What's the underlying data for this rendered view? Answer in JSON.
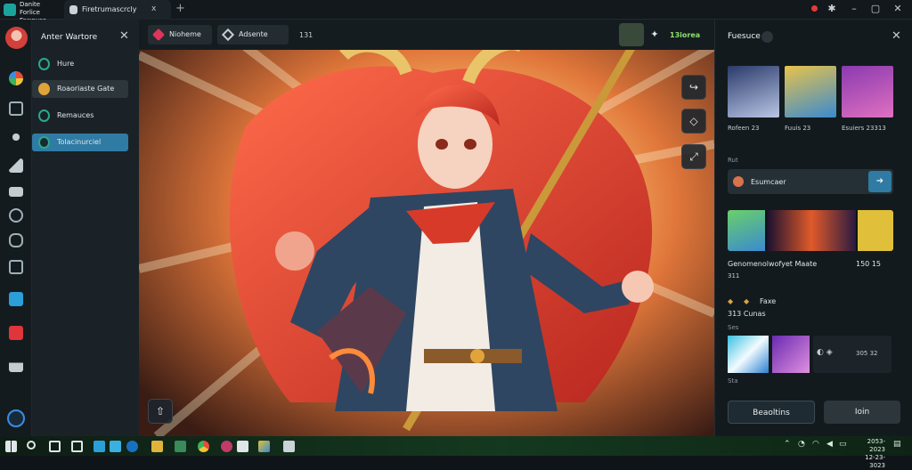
{
  "window": {
    "app_title": "Danite Forlice Fawouse",
    "tab_label": "Firetrumascrcly",
    "tab_close": "ⅹ",
    "new_tab": "+"
  },
  "sidebar": {
    "title": "Anter Wartore",
    "items": [
      {
        "label": "Hure",
        "icon_color": "#2aa98c"
      },
      {
        "label": "Roaoriaste Gate",
        "icon_color": "#e0a43a"
      },
      {
        "label": "Remauces",
        "icon_color": "#2aa98c"
      },
      {
        "label": "Tolacinurciel",
        "icon_color": "#2aa98c"
      }
    ]
  },
  "toolbar": {
    "pill1_label": "Nioheme",
    "pill2_label": "Adsente",
    "count": "131",
    "score_label": "13iorea"
  },
  "right_panel": {
    "title": "Fuesuce",
    "gallery": [
      {
        "caption": "Rofeen 23"
      },
      {
        "caption": "Fuuis 23"
      },
      {
        "caption": "Esuiers 23313"
      }
    ],
    "section1": "Rut",
    "search_label": "Esumcaer",
    "card_label": "Genomenolwofyet Maate",
    "card_value": "150 15",
    "card_sub": "311",
    "sub_row1": "Faxe",
    "sub_row2": "313 Cunas",
    "section2": "Ses",
    "mini_count": "305 32",
    "section3": "Sta",
    "btn_secondary": "Beaoltins",
    "btn_primary": "Ioin"
  },
  "taskbar": {
    "clock_line1": "2053-2023",
    "clock_line2": "12-23-3023"
  },
  "colors": {
    "accent": "#2aa98c",
    "highlight_item": "#2f7ba3",
    "score": "#8fe36b"
  }
}
